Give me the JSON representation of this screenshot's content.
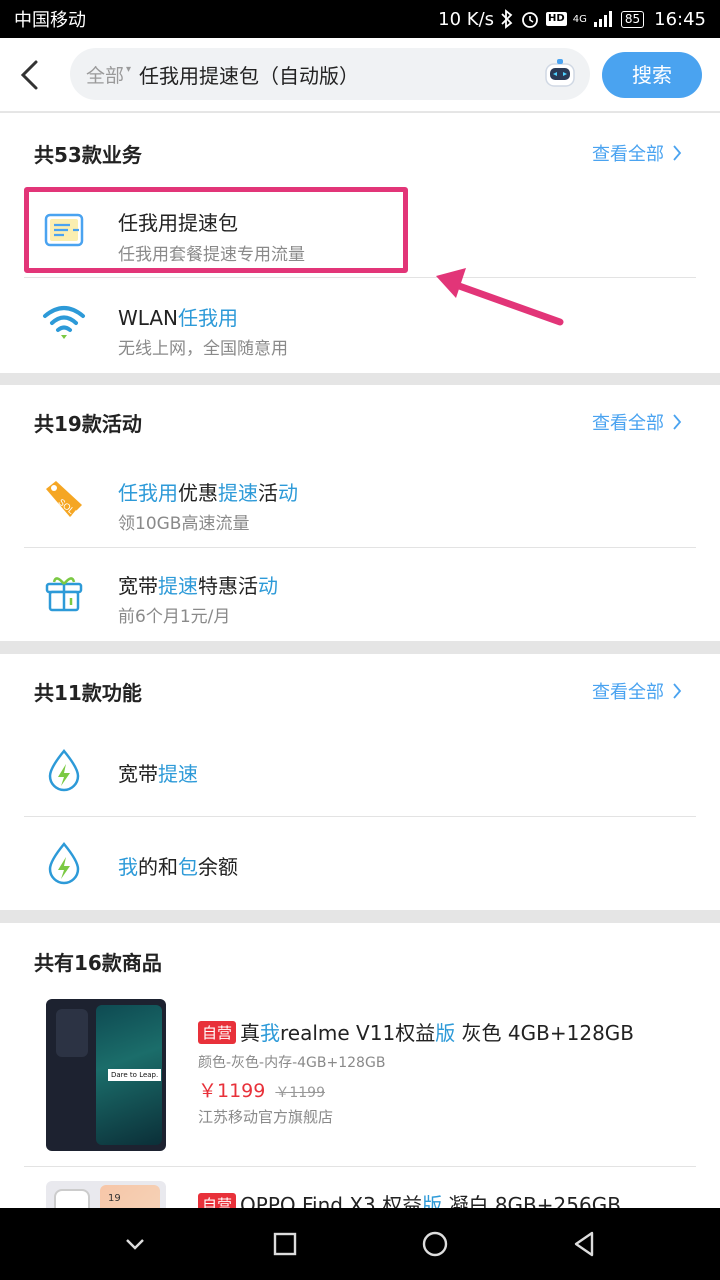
{
  "status": {
    "carrier": "中国移动",
    "speed": "10 K/s",
    "net": "4G",
    "battery": "85",
    "time": "16:45"
  },
  "search": {
    "scope": "全部",
    "query": "任我用提速包（自动版）",
    "button": "搜索"
  },
  "services": {
    "heading": "共53款业务",
    "view_all": "查看全部",
    "items": [
      {
        "title": "任我用提速包",
        "sub": "任我用套餐提速专用流量"
      },
      {
        "title_a": "WLAN",
        "title_b": "任我用",
        "sub": "无线上网，全国随意用"
      }
    ]
  },
  "activities": {
    "heading": "共19款活动",
    "view_all": "查看全部",
    "items": [
      {
        "t1": "任我用",
        "t2": "优惠",
        "t3": "提速",
        "t4": "活",
        "t5": "动",
        "sub": "领10GB高速流量",
        "tag": "SOLD"
      },
      {
        "t1": "宽带",
        "t2": "提速",
        "t3": "特惠活",
        "t4": "动",
        "sub": "前6个月1元/月"
      }
    ]
  },
  "functions": {
    "heading": "共11款功能",
    "view_all": "查看全部",
    "items": [
      {
        "t1": "宽带",
        "t2": "提速"
      },
      {
        "t1": "我",
        "t2": "的和",
        "t3": "包",
        "t4": "余额"
      }
    ]
  },
  "products": {
    "heading": "共有16款商品",
    "items": [
      {
        "badge": "自营",
        "t1": "真",
        "t2": "我",
        "t3": "realme V11权益",
        "t4": "版",
        "t5": " 灰色 4GB+128GB",
        "spec": "颜色-灰色-内存-4GB+128GB",
        "price": "￥1199",
        "old_price": "￥1199",
        "shop": "江苏移动官方旗舰店",
        "screen_text": "Dare to Leap."
      },
      {
        "badge": "自营",
        "t1": "OPPO Find X3 权益",
        "t2": "版",
        "t3": " 凝白 8GB+256GB",
        "screen_text": "19"
      }
    ]
  }
}
